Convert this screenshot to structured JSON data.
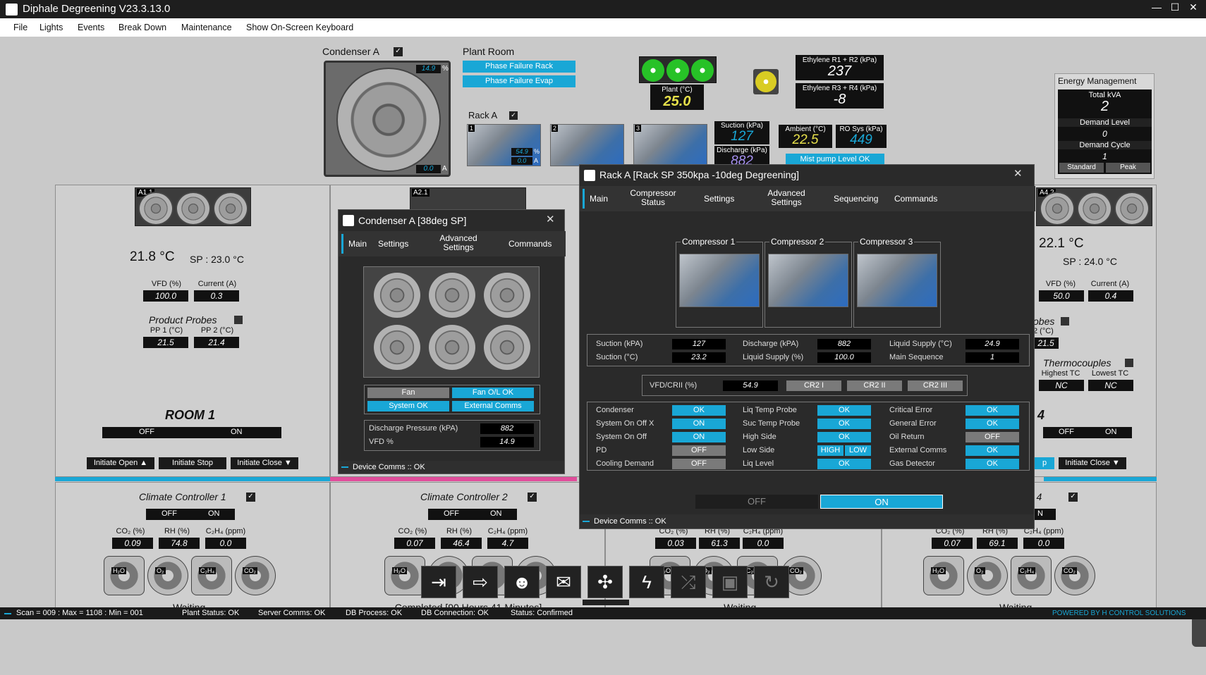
{
  "window": {
    "title": "Diphale Degreening V23.3.13.0"
  },
  "menu": [
    "File",
    "Lights",
    "Events",
    "Break Down",
    "Maintenance",
    "Show On-Screen Keyboard"
  ],
  "condenser": {
    "title": "Condenser A",
    "pct": "14.9",
    "pct_unit": "%",
    "amps": "0.0",
    "amps_unit": "A"
  },
  "plant_room": {
    "title": "Plant Room",
    "btn1": "Phase Failure Rack",
    "btn2": "Phase Failure Evap",
    "plant_label": "Plant (°C)",
    "plant_val": "25.0",
    "rack_title": "Rack A",
    "rack_nums": [
      "1",
      "2",
      "3"
    ],
    "rack1_pct": "54.9",
    "rack1_pct_unit": "%",
    "rack1_amps": "0.0",
    "rack1_amps_unit": "A",
    "suction_label": "Suction (kPa)",
    "suction_val": "127",
    "discharge_label": "Discharge (kPa)",
    "discharge_val": "882",
    "ambient_label": "Ambient (°C)",
    "ambient_val": "22.5",
    "ro_label": "RO Sys (kPa)",
    "ro_val": "449",
    "mist_btn": "Mist pump Level OK",
    "eth12_label": "Ethylene R1 + R2 (kPa)",
    "eth12_val": "237",
    "eth34_label": "Ethylene R3 + R4 (kPa)",
    "eth34_val": "-8"
  },
  "energy": {
    "title": "Energy Management",
    "kva_label": "Total kVA",
    "kva_val": "2",
    "dl_label": "Demand Level",
    "dl_val": "0",
    "dc_label": "Demand Cycle",
    "dc_val": "1",
    "standard": "Standard",
    "peak": "Peak"
  },
  "room1": {
    "fan_tag": "A1.1",
    "temp": "21.8 °C",
    "sp": "SP : 23.0 °C",
    "vfd_label": "VFD (%)",
    "vfd_val": "100.0",
    "cur_label": "Current (A)",
    "cur_val": "0.3",
    "probes": "Product Probes",
    "pp1_label": "PP 1 (°C)",
    "pp1_val": "21.5",
    "pp2_label": "PP 2 (°C)",
    "pp2_val": "21.4",
    "name": "ROOM 1",
    "off": "OFF",
    "on": "ON",
    "initiate_open": "Initiate Open ▲",
    "initiate_stop": "Initiate Stop",
    "initiate_close": "Initiate Close ▼"
  },
  "room2": {
    "fan_tag": "A2.1"
  },
  "room4": {
    "fan_tag": "A4.2",
    "temp": "22.1 °C",
    "sp": "SP : 24.0 °C",
    "vfd_label": "VFD (%)",
    "vfd_val": "50.0",
    "cur_label": "Current (A)",
    "cur_val": "0.4",
    "probes_partial": "obes",
    "pp2_partial": "2 (°C)",
    "pp_partial_val": "21.5",
    "tc_title": "Thermocouples",
    "htc": "Highest TC",
    "ltc": "Lowest TC",
    "htc_val": "NC",
    "ltc_val": "NC",
    "name_partial": "4",
    "off": "OFF",
    "on": "ON",
    "initiate_partial": "p",
    "initiate_close": "Initiate Close ▼"
  },
  "climate": [
    {
      "title": "Climate Controller 1",
      "off": "OFF",
      "on": "ON",
      "co2_label": "CO₂ (%)",
      "co2": "0.09",
      "rh_label": "RH (%)",
      "rh": "74.8",
      "c2h4_label": "C₂H₄ (ppm)",
      "c2h4": "0.0",
      "status": "Waiting..."
    },
    {
      "title": "Climate Controller 2",
      "off": "OFF",
      "on": "ON",
      "co2_label": "CO₂ (%)",
      "co2": "0.07",
      "rh_label": "RH (%)",
      "rh": "46.4",
      "c2h4_label": "C₂H₄ (ppm)",
      "c2h4": "4.7",
      "status": "Completed [90 Hours 41 Minutes]"
    },
    {
      "title": "",
      "off": "",
      "on": "",
      "co2_label": "CO₂ (%)",
      "co2": "0.03",
      "rh_label": "RH (%)",
      "rh": "61.3",
      "c2h4_label": "C₂H₄ (ppm)",
      "c2h4": "0.0",
      "status": "Waiting..."
    },
    {
      "title": "ller 4",
      "off": "",
      "on": "N",
      "co2_label": "CO₂ (%)",
      "co2": "0.07",
      "rh_label": "RH (%)",
      "rh": "69.1",
      "c2h4_label": "C₂H₄ (ppm)",
      "c2h4": "0.0",
      "status": "Waiting..."
    }
  ],
  "climate_icons": [
    "H₂O",
    "O₂",
    "C₂H₄",
    "CO₂"
  ],
  "cond_dialog": {
    "title": "Condenser A [38deg SP]",
    "close": "✕",
    "tabs": [
      "Main",
      "Settings",
      "Advanced Settings",
      "Commands"
    ],
    "fan": "Fan",
    "fan_ol": "Fan O/L OK",
    "system_ok": "System OK",
    "ext_comms": "External Comms",
    "dp_label": "Discharge Pressure (kPA)",
    "dp_val": "882",
    "vfd_label": "VFD %",
    "vfd_val": "14.9",
    "device": "Device Comms :: OK"
  },
  "rack_dialog": {
    "title": "Rack A [Rack SP 350kpa -10deg Degreening]",
    "close": "✕",
    "tabs": [
      "Main",
      "Compressor Status",
      "Settings",
      "Advanced Settings",
      "Sequencing",
      "Commands"
    ],
    "compressors": [
      "Compressor 1",
      "Compressor 2",
      "Compressor 3"
    ],
    "readings": [
      [
        "Suction (kPA)",
        "127",
        "Discharge (kPA)",
        "882",
        "Liquid Supply (°C)",
        "24.9"
      ],
      [
        "Suction (°C)",
        "23.2",
        "Liquid Supply (%)",
        "100.0",
        "Main Sequence",
        "1"
      ]
    ],
    "vfd_label": "VFD/CRII (%)",
    "vfd_val": "54.9",
    "cr": [
      "CR2 I",
      "CR2 II",
      "CR2 III"
    ],
    "status": [
      [
        "Condenser",
        "OK",
        "Liq Temp Probe",
        "OK",
        "Critical Error",
        "OK"
      ],
      [
        "System On Off X",
        "ON",
        "Suc Temp Probe",
        "OK",
        "General Error",
        "OK"
      ],
      [
        "System On Off",
        "ON",
        "High Side",
        "OK",
        "Oil Return",
        "OFF"
      ],
      [
        "PD",
        "OFF",
        "Low Side",
        "HIGH|LOW",
        "External Comms",
        "OK"
      ],
      [
        "Cooling Demand",
        "OFF",
        "Liq Level",
        "OK",
        "Gas Detector",
        "OK"
      ]
    ],
    "off": "OFF",
    "on": "ON",
    "device": "Device Comms :: OK"
  },
  "status_bar": {
    "scan": "Scan = 009 : Max = 1108 : Min = 001",
    "plant": "Plant Status: OK",
    "server": "Server Comms: OK",
    "db_proc": "DB Process:  OK",
    "db_conn": "DB Connection:  OK",
    "status": "Status:  Confirmed",
    "powered": "POWERED BY H CONTROL SOLUTIONS"
  },
  "colors": {
    "accent": "#19a7d6",
    "pink": "#e04d9b",
    "dark": "#2a2a2a"
  }
}
